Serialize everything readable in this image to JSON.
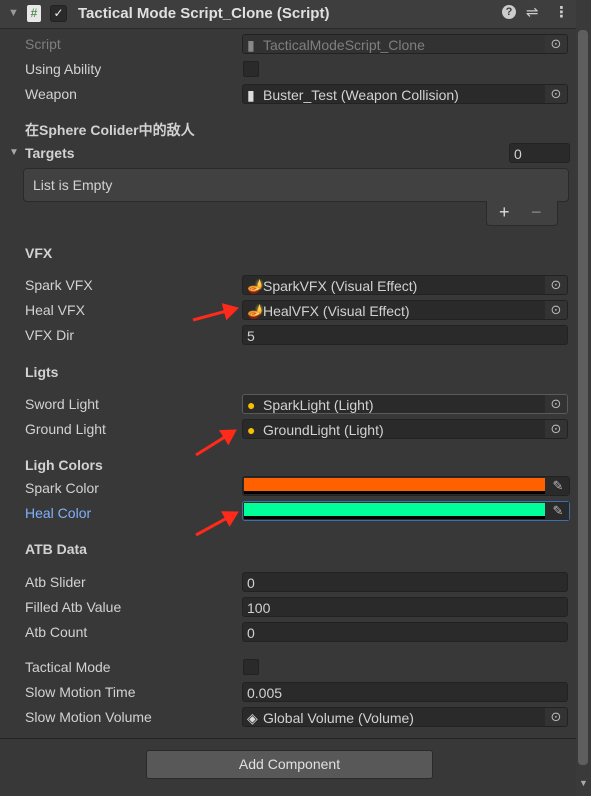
{
  "header": {
    "title": "Tactical Mode Script_Clone (Script)",
    "enabled": true
  },
  "fields": {
    "script": {
      "label": "Script",
      "value": "TacticalModeScript_Clone"
    },
    "using_ability": {
      "label": "Using Ability",
      "checked": false
    },
    "weapon": {
      "label": "Weapon",
      "value": "Buster_Test (Weapon Collision)"
    },
    "targets_header": "在Sphere Colider中的敌人",
    "targets": {
      "label": "Targets",
      "count": "0",
      "empty_text": "List is Empty",
      "add": "+",
      "remove": "−"
    },
    "vfx_section": "VFX",
    "spark_vfx": {
      "label": "Spark VFX",
      "value": "SparkVFX (Visual Effect)"
    },
    "heal_vfx": {
      "label": "Heal VFX",
      "value": "HealVFX (Visual Effect)"
    },
    "vfx_dir": {
      "label": "VFX Dir",
      "value": "5"
    },
    "lights_section": "Ligts",
    "sword_light": {
      "label": "Sword Light",
      "value": "SparkLight (Light)"
    },
    "ground_light": {
      "label": "Ground Light",
      "value": "GroundLight (Light)"
    },
    "colors_section": "Ligh Colors",
    "spark_color": {
      "label": "Spark Color",
      "color": "#ff6100"
    },
    "heal_color": {
      "label": "Heal Color",
      "color": "#00ff99"
    },
    "atb_section": "ATB Data",
    "atb_slider": {
      "label": "Atb Slider",
      "value": "0"
    },
    "filled_atb": {
      "label": "Filled Atb Value",
      "value": "100"
    },
    "atb_count": {
      "label": "Atb Count",
      "value": "0"
    },
    "tactical_mode": {
      "label": "Tactical Mode",
      "checked": false
    },
    "slow_motion_time": {
      "label": "Slow Motion Time",
      "value": "0.005"
    },
    "slow_motion_volume": {
      "label": "Slow Motion Volume",
      "value": "Global Volume (Volume)"
    }
  },
  "add_component": "Add Component",
  "annotation_color": "#ff2a1a"
}
